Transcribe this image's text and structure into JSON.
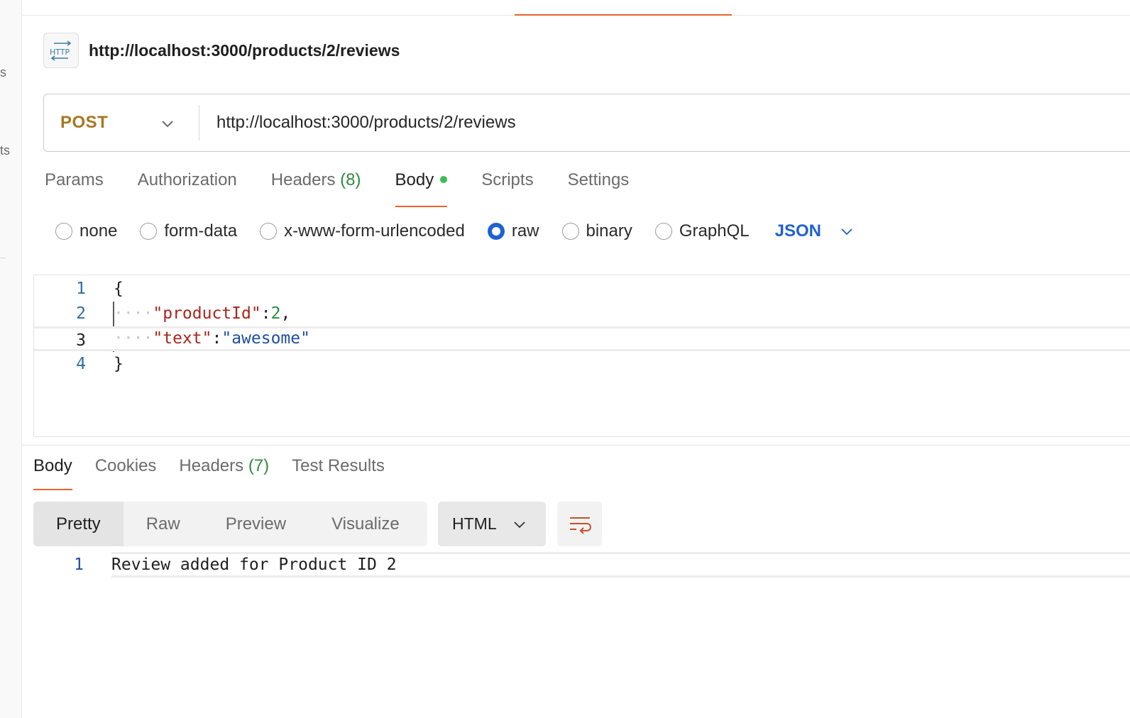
{
  "left_rail": {
    "fragments": [
      "s",
      "ts"
    ]
  },
  "request": {
    "title": "http://localhost:3000/products/2/reviews",
    "method": "POST",
    "url": "http://localhost:3000/products/2/reviews"
  },
  "request_tabs": [
    {
      "label": "Params"
    },
    {
      "label": "Authorization"
    },
    {
      "label": "Headers",
      "count": "(8)"
    },
    {
      "label": "Body"
    },
    {
      "label": "Scripts"
    },
    {
      "label": "Settings"
    }
  ],
  "body_types": [
    {
      "label": "none",
      "selected": false
    },
    {
      "label": "form-data",
      "selected": false
    },
    {
      "label": "x-www-form-urlencoded",
      "selected": false
    },
    {
      "label": "raw",
      "selected": true
    },
    {
      "label": "binary",
      "selected": false
    },
    {
      "label": "GraphQL",
      "selected": false
    }
  ],
  "raw_format": "JSON",
  "editor": {
    "line_numbers": [
      "1",
      "2",
      "3",
      "4"
    ],
    "open_brace": "{",
    "close_brace": "}",
    "indent": "····",
    "key1": "\"productId\"",
    "colon": ":",
    "val1": "2",
    "comma": ",",
    "key2": "\"text\"",
    "val2": "\"awesome\""
  },
  "response_tabs": [
    {
      "label": "Body"
    },
    {
      "label": "Cookies"
    },
    {
      "label": "Headers",
      "count": "(7)"
    },
    {
      "label": "Test Results"
    }
  ],
  "view_modes": [
    "Pretty",
    "Raw",
    "Preview",
    "Visualize"
  ],
  "response_format": "HTML",
  "response": {
    "line_number": "1",
    "text": "Review added for Product ID 2"
  }
}
